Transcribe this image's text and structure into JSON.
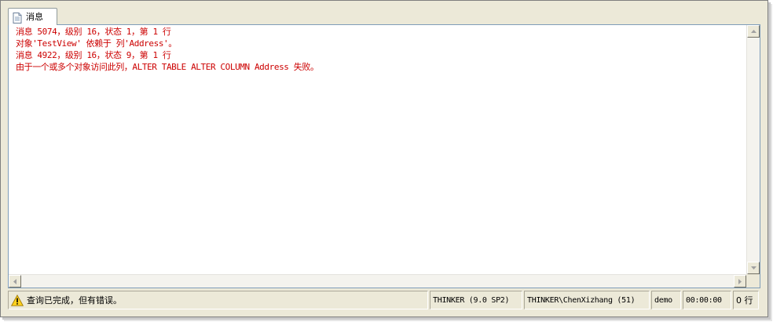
{
  "tab": {
    "label": "消息",
    "icon": "document-icon"
  },
  "messages": [
    "消息 5074，级别 16，状态 1，第 1 行",
    "对象'TestView' 依赖于 列'Address'。",
    "消息 4922，级别 16，状态 9，第 1 行",
    "由于一个或多个对象访问此列，ALTER TABLE ALTER COLUMN Address 失败。"
  ],
  "message_color": "#cc0000",
  "status": {
    "icon": "warning-icon",
    "text": "查询已完成，但有错误。",
    "server": "THINKER (9.0 SP2)",
    "user": "THINKER\\ChenXizhang (51)",
    "database": "demo",
    "elapsed": "00:00:00",
    "rows": "0 行"
  }
}
